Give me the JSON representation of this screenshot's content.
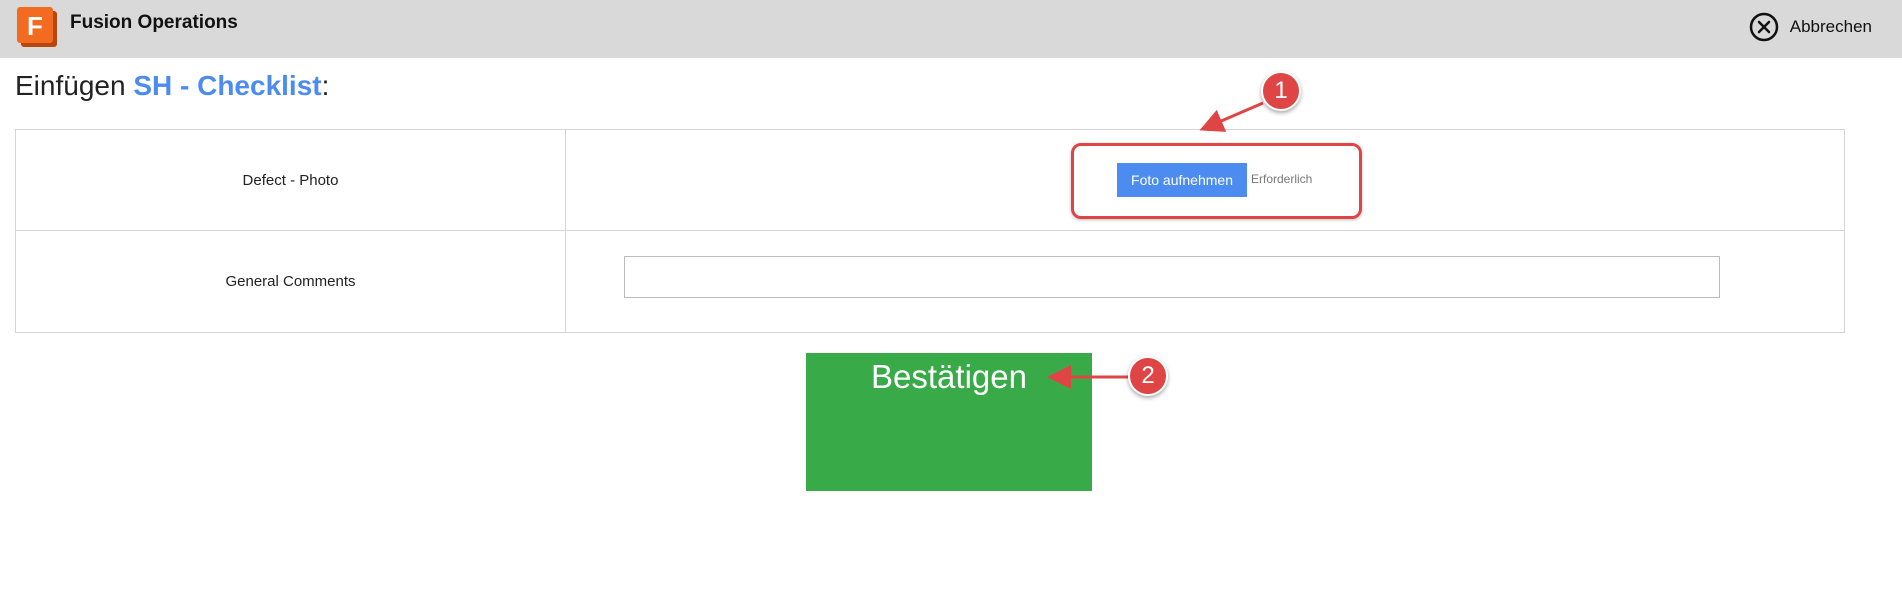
{
  "header": {
    "app_title": "Fusion Operations",
    "logo_letter": "F",
    "cancel_label": "Abbrechen",
    "icons": {
      "logo": "fusion-logo-icon",
      "cancel": "close-circle-icon"
    }
  },
  "page": {
    "heading_prefix": "Einfügen",
    "heading_name": "SH - Checklist",
    "heading_suffix": ":"
  },
  "form": {
    "rows": [
      {
        "label": "Defect - Photo",
        "button_label": "Foto aufnehmen",
        "required_text": "Erforderlich"
      },
      {
        "label": "General Comments",
        "input_value": "",
        "input_placeholder": ""
      }
    ],
    "confirm_label": "Bestätigen"
  },
  "annotations": {
    "marker_1": "1",
    "marker_2": "2"
  },
  "colors": {
    "accent_blue": "#4c8bef",
    "confirm_green": "#38ab48",
    "annotation_red": "#e04545",
    "header_bg": "#d9d9d9",
    "logo_orange": "#f26b21"
  }
}
